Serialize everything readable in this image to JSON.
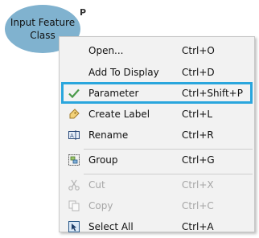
{
  "node": {
    "label_line1": "Input Feature",
    "label_line2": "Class",
    "badge": "P"
  },
  "menu": {
    "items": [
      {
        "label": "Open...",
        "shortcut": "Ctrl+O",
        "icon": "none"
      },
      {
        "label": "Add To Display",
        "shortcut": "Ctrl+D",
        "icon": "none"
      },
      {
        "label": "Parameter",
        "shortcut": "Ctrl+Shift+P",
        "icon": "checkmark-icon",
        "checked": true
      },
      {
        "label": "Create Label",
        "shortcut": "Ctrl+L",
        "icon": "label-tag-icon"
      },
      {
        "label": "Rename",
        "shortcut": "Ctrl+R",
        "icon": "rename-icon"
      },
      {
        "label": "Group",
        "shortcut": "Ctrl+G",
        "icon": "group-icon"
      },
      {
        "label": "Cut",
        "shortcut": "Ctrl+X",
        "icon": "scissors-icon",
        "disabled": true
      },
      {
        "label": "Copy",
        "shortcut": "Ctrl+C",
        "icon": "copy-icon",
        "disabled": true
      },
      {
        "label": "Select All",
        "shortcut": "Ctrl+A",
        "icon": "select-all-icon"
      }
    ]
  },
  "colors": {
    "node_fill": "#80b2cf",
    "highlight_border": "#2aa6dd",
    "checkmark": "#4a9a4a",
    "disabled_text": "#a6a6a6"
  }
}
